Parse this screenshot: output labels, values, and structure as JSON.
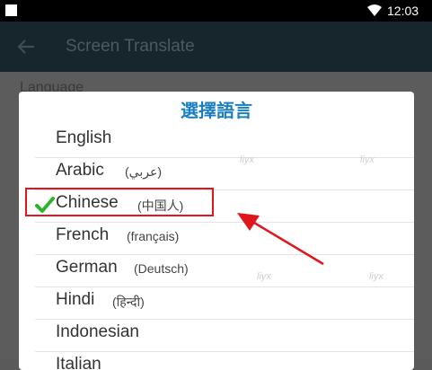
{
  "status_bar": {
    "time": "12:03"
  },
  "app_bar": {
    "title": "Screen Translate"
  },
  "background": {
    "language_label": "Language"
  },
  "dialog": {
    "title": "選擇語言",
    "items": [
      {
        "name": "English",
        "native": ""
      },
      {
        "name": "Arabic",
        "native": "(عربي)"
      },
      {
        "name": "Chinese",
        "native": "(中国人)",
        "selected": true
      },
      {
        "name": "French",
        "native": "(français)"
      },
      {
        "name": "German",
        "native": "(Deutsch)"
      },
      {
        "name": "Hindi",
        "native": "(हिन्दी)"
      },
      {
        "name": "Indonesian",
        "native": ""
      },
      {
        "name": "Italian",
        "native": ""
      }
    ]
  },
  "watermark": "liyx",
  "colors": {
    "accent": "#1a7fc1",
    "check": "#2cb52c",
    "annotation": "#e0161d",
    "app_bar": "#17252d"
  }
}
